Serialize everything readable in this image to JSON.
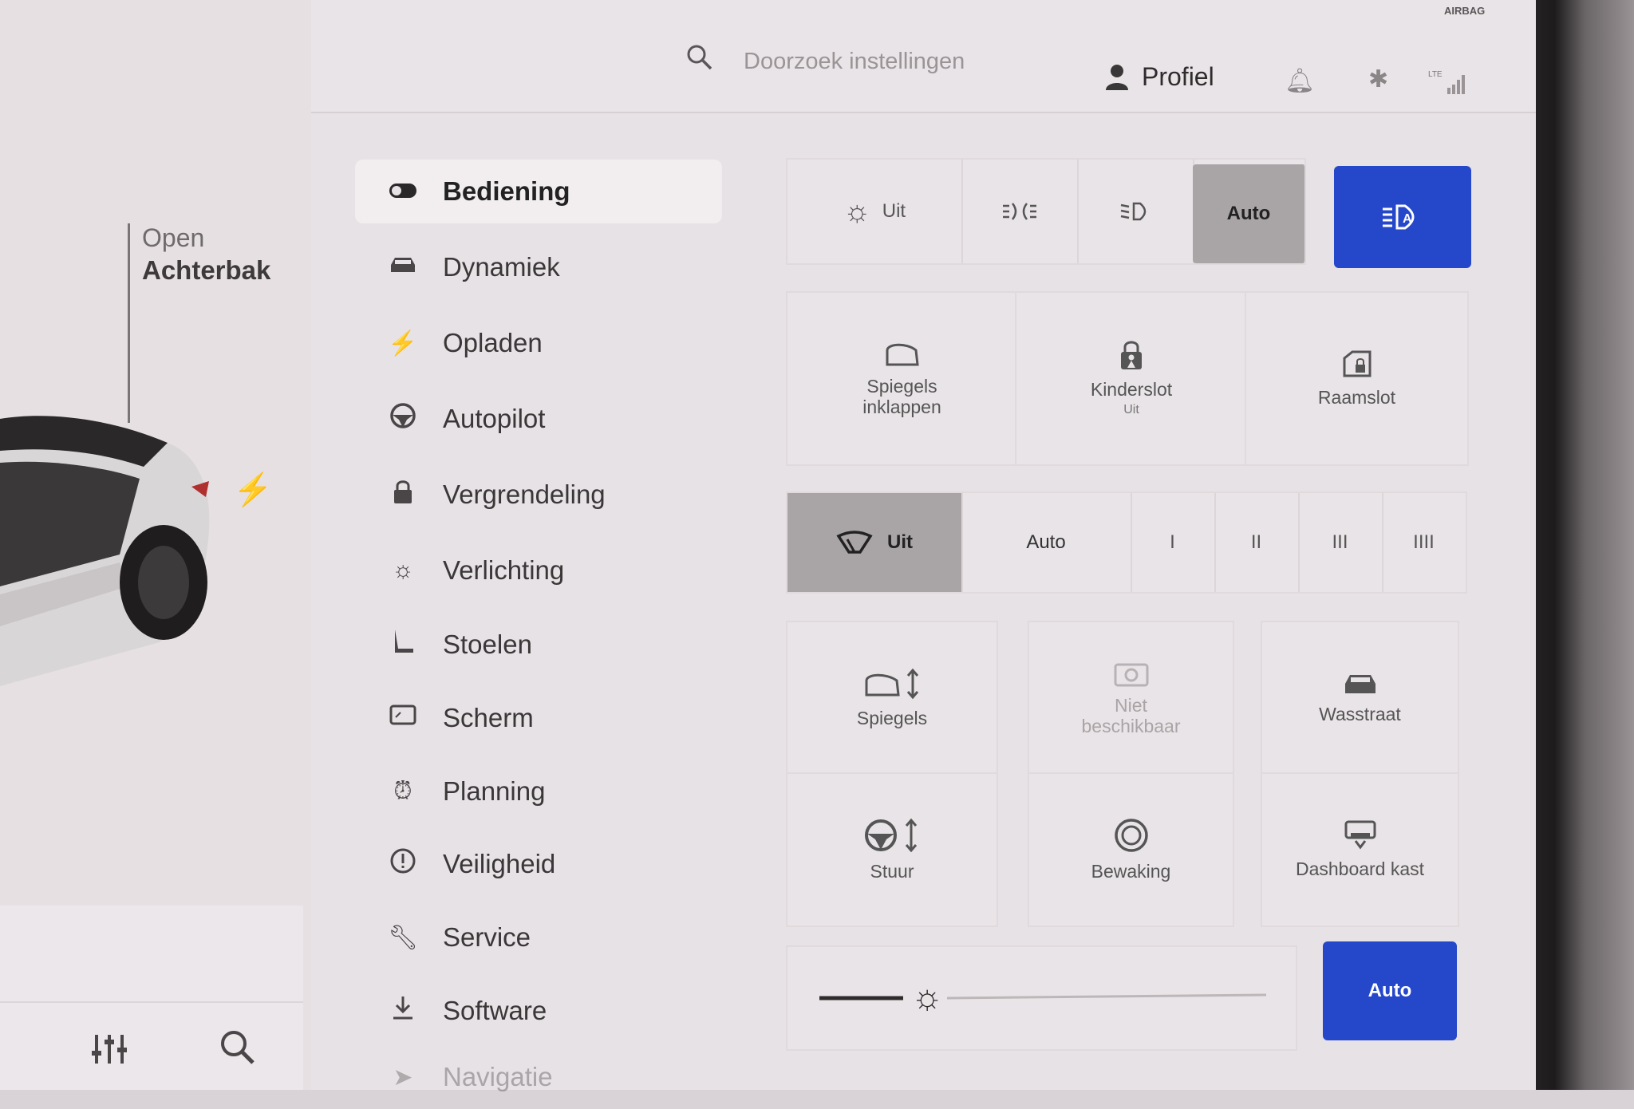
{
  "header": {
    "search_placeholder": "Doorzoek instellingen",
    "profile_label": "Profiel",
    "airbag_label": "AIRBAG"
  },
  "car_panel": {
    "trunk_action": "Open",
    "trunk_name": "Achterbak"
  },
  "nav": {
    "items": [
      {
        "label": "Bediening",
        "icon": "toggle-icon",
        "active": true
      },
      {
        "label": "Dynamiek",
        "icon": "car-icon"
      },
      {
        "label": "Opladen",
        "icon": "bolt-icon"
      },
      {
        "label": "Autopilot",
        "icon": "steering-wheel-icon"
      },
      {
        "label": "Vergrendeling",
        "icon": "lock-icon"
      },
      {
        "label": "Verlichting",
        "icon": "sun-icon"
      },
      {
        "label": "Stoelen",
        "icon": "seat-icon"
      },
      {
        "label": "Scherm",
        "icon": "screen-icon"
      },
      {
        "label": "Planning",
        "icon": "alarm-icon"
      },
      {
        "label": "Veiligheid",
        "icon": "alert-icon"
      },
      {
        "label": "Service",
        "icon": "wrench-icon"
      },
      {
        "label": "Software",
        "icon": "download-icon"
      },
      {
        "label": "Navigatie",
        "icon": "navigation-icon"
      }
    ]
  },
  "lights": {
    "off_label": "Uit",
    "auto_label": "Auto",
    "selected": "Auto"
  },
  "tiles_row1": {
    "mirrors_fold": "Spiegels inklappen",
    "child_lock": "Kinderslot",
    "child_lock_state": "Uit",
    "window_lock": "Raamslot"
  },
  "wipers": {
    "off_label": "Uit",
    "auto_label": "Auto",
    "speed1": "I",
    "speed2": "II",
    "speed3": "III",
    "speed4": "IIII",
    "selected": "Uit"
  },
  "tiles_row2": {
    "mirrors": "Spiegels",
    "unavailable_line1": "Niet",
    "unavailable_line2": "beschikbaar",
    "carwash": "Wasstraat",
    "steering": "Stuur",
    "sentry": "Bewaking",
    "glovebox": "Dashboard kast"
  },
  "brightness": {
    "auto_label": "Auto"
  },
  "colors": {
    "accent_blue": "#2547c9",
    "selected_gray": "#a9a4a6"
  }
}
